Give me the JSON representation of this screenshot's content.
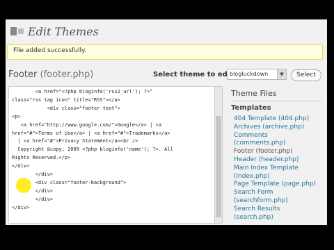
{
  "header": {
    "title": "Edit Themes"
  },
  "notice": {
    "text": "File added successfully."
  },
  "editor": {
    "file_label": "Footer",
    "file_name": "(footer.php)",
    "select_label": "Select theme to edit:",
    "selected_theme": "blogluckdown",
    "select_button": "Select",
    "code": "        <a href=\"<?php bloginfo('rss2_url'); ?>\"\nclass=\"rss tag icon\" title=\"RSS\"></a>\n            <div class=\"footer text\">\n<p>\n   <a href=\"http://www.google.com/\">Google</a> | <a\nhref=\"#\">Terms of Use</a> | <a href=\"#\">Trademarks</a>\n  | <a href=\"#\">Privacy Statement</a><br />\n  Copyright &copy; 2009 <?php bloginfo('name'); ?>. All\nRights Reserved.</p>\n</div>\n        </div>\n        <div class=\"footer-background\">\n        </div>\n        </div>\n</div>"
  },
  "sidebar": {
    "title": "Theme Files",
    "section": "Templates",
    "items": [
      {
        "label": "404 Template (404.php)"
      },
      {
        "label": "Archives (archive.php)"
      },
      {
        "label": "Comments"
      },
      {
        "label": "(comments.php)"
      },
      {
        "label": "Footer (footer.php)"
      },
      {
        "label": "Header (header.php)"
      },
      {
        "label": "Main Index Template"
      },
      {
        "label": "(index.php)"
      },
      {
        "label": "Page Template (page.php)"
      },
      {
        "label": "Search Form"
      },
      {
        "label": "(searchform.php)"
      },
      {
        "label": "Search Results"
      },
      {
        "label": "(search.php)"
      }
    ]
  },
  "colors": {
    "link": "#21759b",
    "notice_bg": "#ffffe0",
    "cursor_highlight": "#ffeb00"
  }
}
